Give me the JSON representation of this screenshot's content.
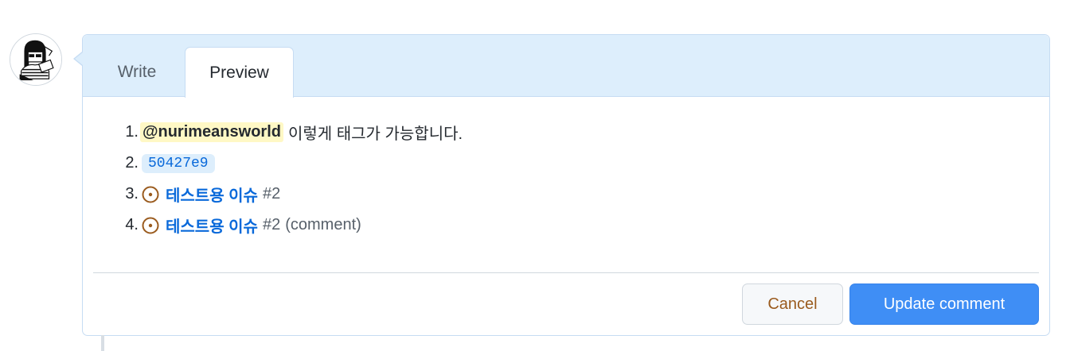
{
  "avatar": {
    "icon": "user-avatar-illustration"
  },
  "tabs": {
    "write_label": "Write",
    "preview_label": "Preview"
  },
  "preview": {
    "items": [
      {
        "number": "1.",
        "mention": "@nurimeansworld",
        "text": "이렇게 태그가 가능합니다."
      },
      {
        "number": "2.",
        "commit_sha": "50427e9"
      },
      {
        "number": "3.",
        "issue_title": "테스트용 이슈",
        "issue_number": "#2",
        "suffix": ""
      },
      {
        "number": "4.",
        "issue_title": "테스트용 이슈",
        "issue_number": "#2",
        "suffix": "(comment)"
      }
    ],
    "issue_icon": "issue-open-icon",
    "issue_icon_color": "#9a5b1e"
  },
  "actions": {
    "cancel_label": "Cancel",
    "update_label": "Update comment"
  },
  "colors": {
    "accent": "#3f8ef5",
    "link": "#0969da",
    "tab_bg": "#ddeefc",
    "mention_bg": "#fff8c5"
  }
}
